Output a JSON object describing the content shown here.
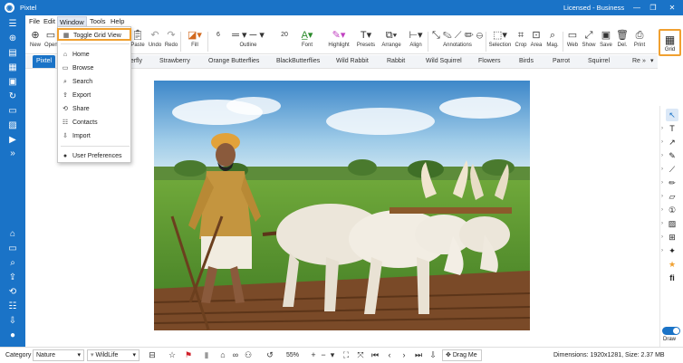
{
  "app": {
    "title": "Pixtel",
    "license": "Licensed - Business"
  },
  "window_controls": {
    "minimize_icon": "minimize-icon",
    "maximize_icon": "maximize-icon",
    "close_icon": "close-icon"
  },
  "menu": [
    "File",
    "Edit",
    "Window",
    "Tools",
    "Help"
  ],
  "toolbar": {
    "new": "New",
    "open": "Open",
    "paste": "Paste",
    "undo": "Undo",
    "redo": "Redo",
    "fill": "Fill",
    "outline_size": "6",
    "outline": "Outline",
    "font_size": "20",
    "font": "Font",
    "highlight": "Highlight",
    "presets": "Presets",
    "arrange": "Arrange",
    "align": "Align",
    "annotations": "Annotations",
    "selection": "Selection",
    "crop": "Crop",
    "area": "Area",
    "mag": "Mag.",
    "web": "Web",
    "show": "Show",
    "save": "Save",
    "del": "Del.",
    "print": "Print",
    "grid": "Grid"
  },
  "tabs": [
    "Pixtel",
    "...erfly",
    "Strawberry",
    "Orange Butterflies",
    "BlackButterflies",
    "Wild Rabbit",
    "Rabbit",
    "Wild Squirrel",
    "Flowers",
    "Birds",
    "Parrot",
    "Squirrel",
    "Re"
  ],
  "window_menu": {
    "items": [
      {
        "label": "Toggle Grid View",
        "icon": "grid-icon"
      },
      {
        "label": "Home",
        "icon": "home-icon"
      },
      {
        "label": "Browse",
        "icon": "folder-icon"
      },
      {
        "label": "Search",
        "icon": "search-icon"
      },
      {
        "label": "Export",
        "icon": "export-icon"
      },
      {
        "label": "Share",
        "icon": "share-icon"
      },
      {
        "label": "Contacts",
        "icon": "contacts-icon"
      },
      {
        "label": "Import",
        "icon": "import-icon"
      },
      {
        "label": "User Preferences",
        "icon": "user-icon"
      }
    ]
  },
  "right_tools": {
    "draw_label": "Draw",
    "draw_on": true
  },
  "status": {
    "category_label": "Category",
    "category_value": "Nature",
    "subcategory_value": "WildLife",
    "zoom": "55%",
    "drag_me": "Drag Me",
    "dimensions": "Dimensions: 1920x1281, Size: 2.37 MB"
  },
  "colors": {
    "accent": "#1a73c7",
    "highlight_border": "#f0a030"
  }
}
